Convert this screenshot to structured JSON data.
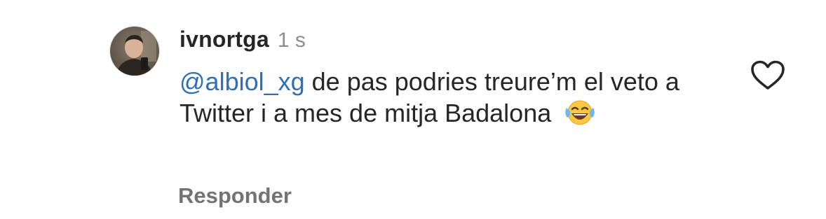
{
  "comment": {
    "username": "ivnortga",
    "timestamp": "1 s",
    "mention": "@albiol_xg",
    "text": " de pas podries treure’m el veto a Twitter i a mes de mitja Badalona ",
    "emoji": "face-with-tears-of-joy-icon",
    "reply_label": "Responder"
  },
  "colors": {
    "username": "#262626",
    "mention": "#2f6fb3",
    "secondary": "#8e8e8e",
    "reply": "#737373"
  }
}
